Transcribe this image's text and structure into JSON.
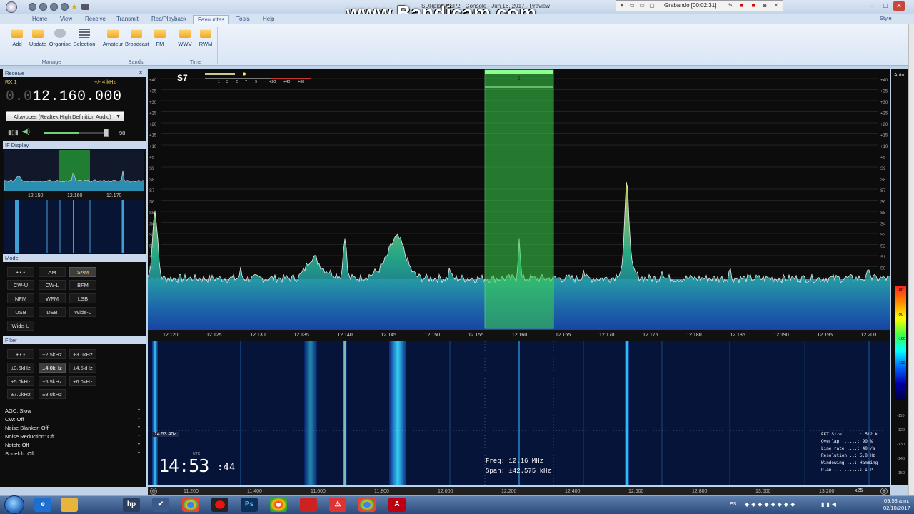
{
  "window": {
    "title": "SDRplay RSP2 - Console - Jun 16, 2017 - Preview",
    "watermark": "www.Bandicam.com",
    "recording": "Grabando [00:02:31]"
  },
  "menu": {
    "home": "Home",
    "view": "View",
    "receive": "Receive",
    "transmit": "Transmit",
    "recplayback": "Rec/Playback",
    "favourites": "Favourites",
    "tools": "Tools",
    "help": "Help",
    "style": "Style"
  },
  "ribbon": {
    "manage": {
      "add": "Add",
      "update": "Update",
      "organise": "Organise",
      "selection": "Selection",
      "label": "Manage"
    },
    "bands": {
      "amateur": "Amateur",
      "broadcast": "Broadcast",
      "fm": "FM",
      "label": "Bands"
    },
    "time": {
      "wwv": "WWV",
      "rwm": "RWM",
      "label": "Time"
    }
  },
  "receive": {
    "header": "Receive",
    "rx": "RX 1",
    "bandwidth": "+/- 4 kHz",
    "freq_dim": "0.0",
    "freq": "12.160.000",
    "audio_device": "Altavoces (Realtek High Definition Audio)",
    "volume": "98",
    "volume_fraction": 0.55
  },
  "if_display": {
    "header": "IF Display",
    "ticks": [
      "12.150",
      "12.160",
      "12.170"
    ]
  },
  "mode": {
    "header": "Mode",
    "buttons": [
      "• • •",
      "AM",
      "SAM",
      "CW-U",
      "CW-L",
      "BFM",
      "NFM",
      "WFM",
      "LSB",
      "USB",
      "DSB",
      "Wide-L",
      "Wide-U"
    ],
    "selected": "SAM"
  },
  "filter": {
    "header": "Filter",
    "buttons": [
      "• • •",
      "±2.5kHz",
      "±3.0kHz",
      "±3.5kHz",
      "±4.0kHz",
      "±4.5kHz",
      "±5.0kHz",
      "±5.5kHz",
      "±6.0kHz",
      "±7.0kHz",
      "±8.0kHz"
    ],
    "selected": "±4.0kHz"
  },
  "status": [
    "AGC: Slow",
    "CW: Off",
    "Noise Blanker: Off",
    "Noise Reduction: Off",
    "Notch: Off",
    "Squelch: Off"
  ],
  "spectrum": {
    "s_meter": "S7",
    "meter_scale": [
      "1",
      "3",
      "5",
      "7",
      "9",
      "+20",
      "+40",
      "+60"
    ],
    "level_labels": [
      "+40",
      "+35",
      "+30",
      "+25",
      "+20",
      "+15",
      "+10",
      "+5",
      "S9",
      "S8",
      "S7",
      "S6",
      "S5",
      "S4",
      "S3",
      "S2",
      "S1",
      "S0",
      "-5 dBm",
      "-10 dBm",
      "-15 dBm"
    ],
    "right_level_labels": [
      "+40",
      "+35",
      "+30",
      "+25",
      "+20",
      "+15",
      "+10",
      "+5",
      "S9",
      "S8",
      "S7",
      "S6",
      "S5",
      "S4",
      "S3",
      "S2",
      "S1",
      "S0",
      "-5 dBm",
      "-10 dBm",
      "-15 dBm"
    ],
    "freq_ticks": [
      "12.120",
      "12.125",
      "12.130",
      "12.135",
      "12.140",
      "12.145",
      "12.150",
      "12.155",
      "12.160",
      "12.165",
      "12.170",
      "12.175",
      "12.180",
      "12.185",
      "12.190",
      "12.195",
      "12.200"
    ],
    "vfo_marker": "1",
    "auto": "Auto",
    "colorbar_labels": [
      "-80",
      "-90",
      "-100",
      "-110",
      "-120"
    ]
  },
  "waterfall": {
    "time_label": "14:53:40z",
    "clock": "14:53",
    "clock_sec": ":44",
    "utc": "UTC",
    "freq_readout": "Freq:   12.16 MHz",
    "span_readout": "Span:  ±42.575 kHz",
    "fft_info": [
      "FFT Size ......: 512 k",
      "Overlap ......: 90 %",
      "Line rate ....: 40 /s",
      "Resolution ..: 5.8 Hz",
      "Windowing ...: Hamming",
      "Plan ..........: IFP"
    ],
    "right_scale": [
      "-110",
      "-120",
      "-130",
      "-140",
      "-150"
    ]
  },
  "bottom_axis": {
    "ticks": [
      "11.200",
      "11.400",
      "11.600",
      "11.800",
      "12.000",
      "12.200",
      "12.400",
      "12.600",
      "12.800",
      "13.000",
      "13.200"
    ],
    "zoom": "x25"
  },
  "taskbar": {
    "lang": "ES",
    "time": "09:53 a.m.",
    "date": "02/10/2017"
  }
}
